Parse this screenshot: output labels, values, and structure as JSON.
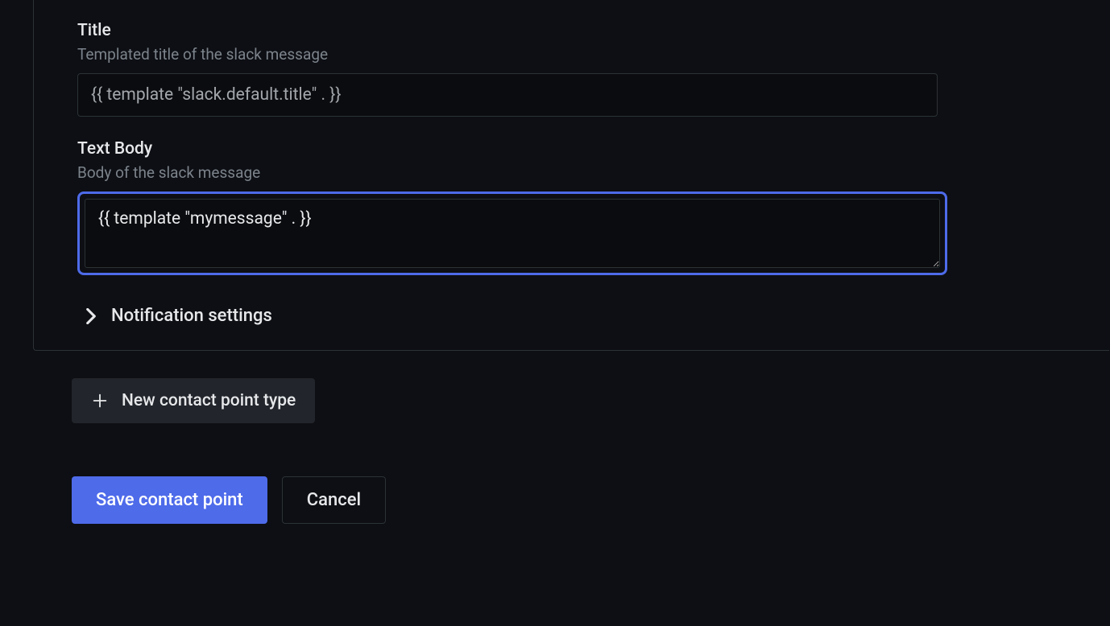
{
  "fields": {
    "title": {
      "label": "Title",
      "help": "Templated title of the slack message",
      "value": "{{ template \"slack.default.title\" . }}"
    },
    "textBody": {
      "label": "Text Body",
      "help": "Body of the slack message",
      "value": "{{ template \"mymessage\" . }}"
    }
  },
  "expandable": {
    "notificationSettings": "Notification settings"
  },
  "buttons": {
    "newContactPointType": "New contact point type",
    "saveContactPoint": "Save contact point",
    "cancel": "Cancel"
  }
}
